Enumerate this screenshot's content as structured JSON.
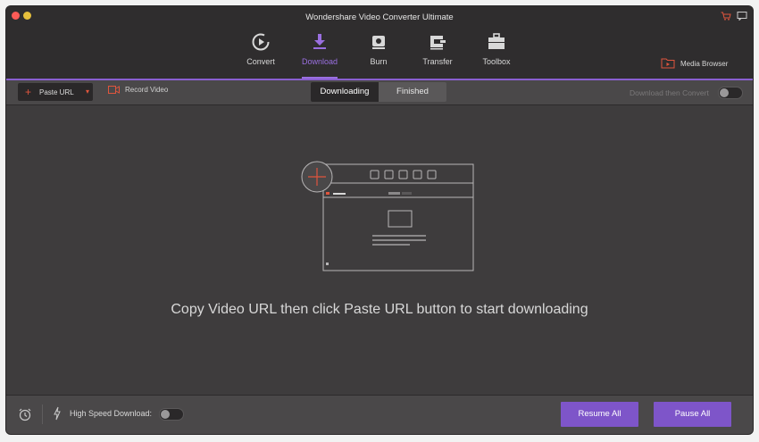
{
  "window": {
    "title": "Wondershare Video Converter Ultimate",
    "icons": {
      "cart": "cart-icon",
      "feedback": "feedback-icon"
    }
  },
  "nav": {
    "items": [
      {
        "label": "Convert",
        "icon": "convert-icon",
        "active": false
      },
      {
        "label": "Download",
        "icon": "download-icon",
        "active": true
      },
      {
        "label": "Burn",
        "icon": "burn-icon",
        "active": false
      },
      {
        "label": "Transfer",
        "icon": "transfer-icon",
        "active": false
      },
      {
        "label": "Toolbox",
        "icon": "toolbox-icon",
        "active": false
      }
    ],
    "media_browser": "Media Browser"
  },
  "toolbar": {
    "paste_url": "Paste URL",
    "record_video": "Record Video",
    "tabs": [
      "Downloading",
      "Finished"
    ],
    "selected_tab": "Downloading",
    "download_then_convert": "Download then Convert",
    "download_then_convert_enabled": false
  },
  "main": {
    "hint": "Copy Video URL then click Paste URL button to start downloading"
  },
  "bottom": {
    "high_speed_label": "High Speed Download:",
    "high_speed_enabled": false,
    "resume_all": "Resume All",
    "pause_all": "Pause All"
  },
  "colors": {
    "accent": "#8a5fd1",
    "button": "#7e55c9",
    "paste_red": "#e0553d"
  }
}
